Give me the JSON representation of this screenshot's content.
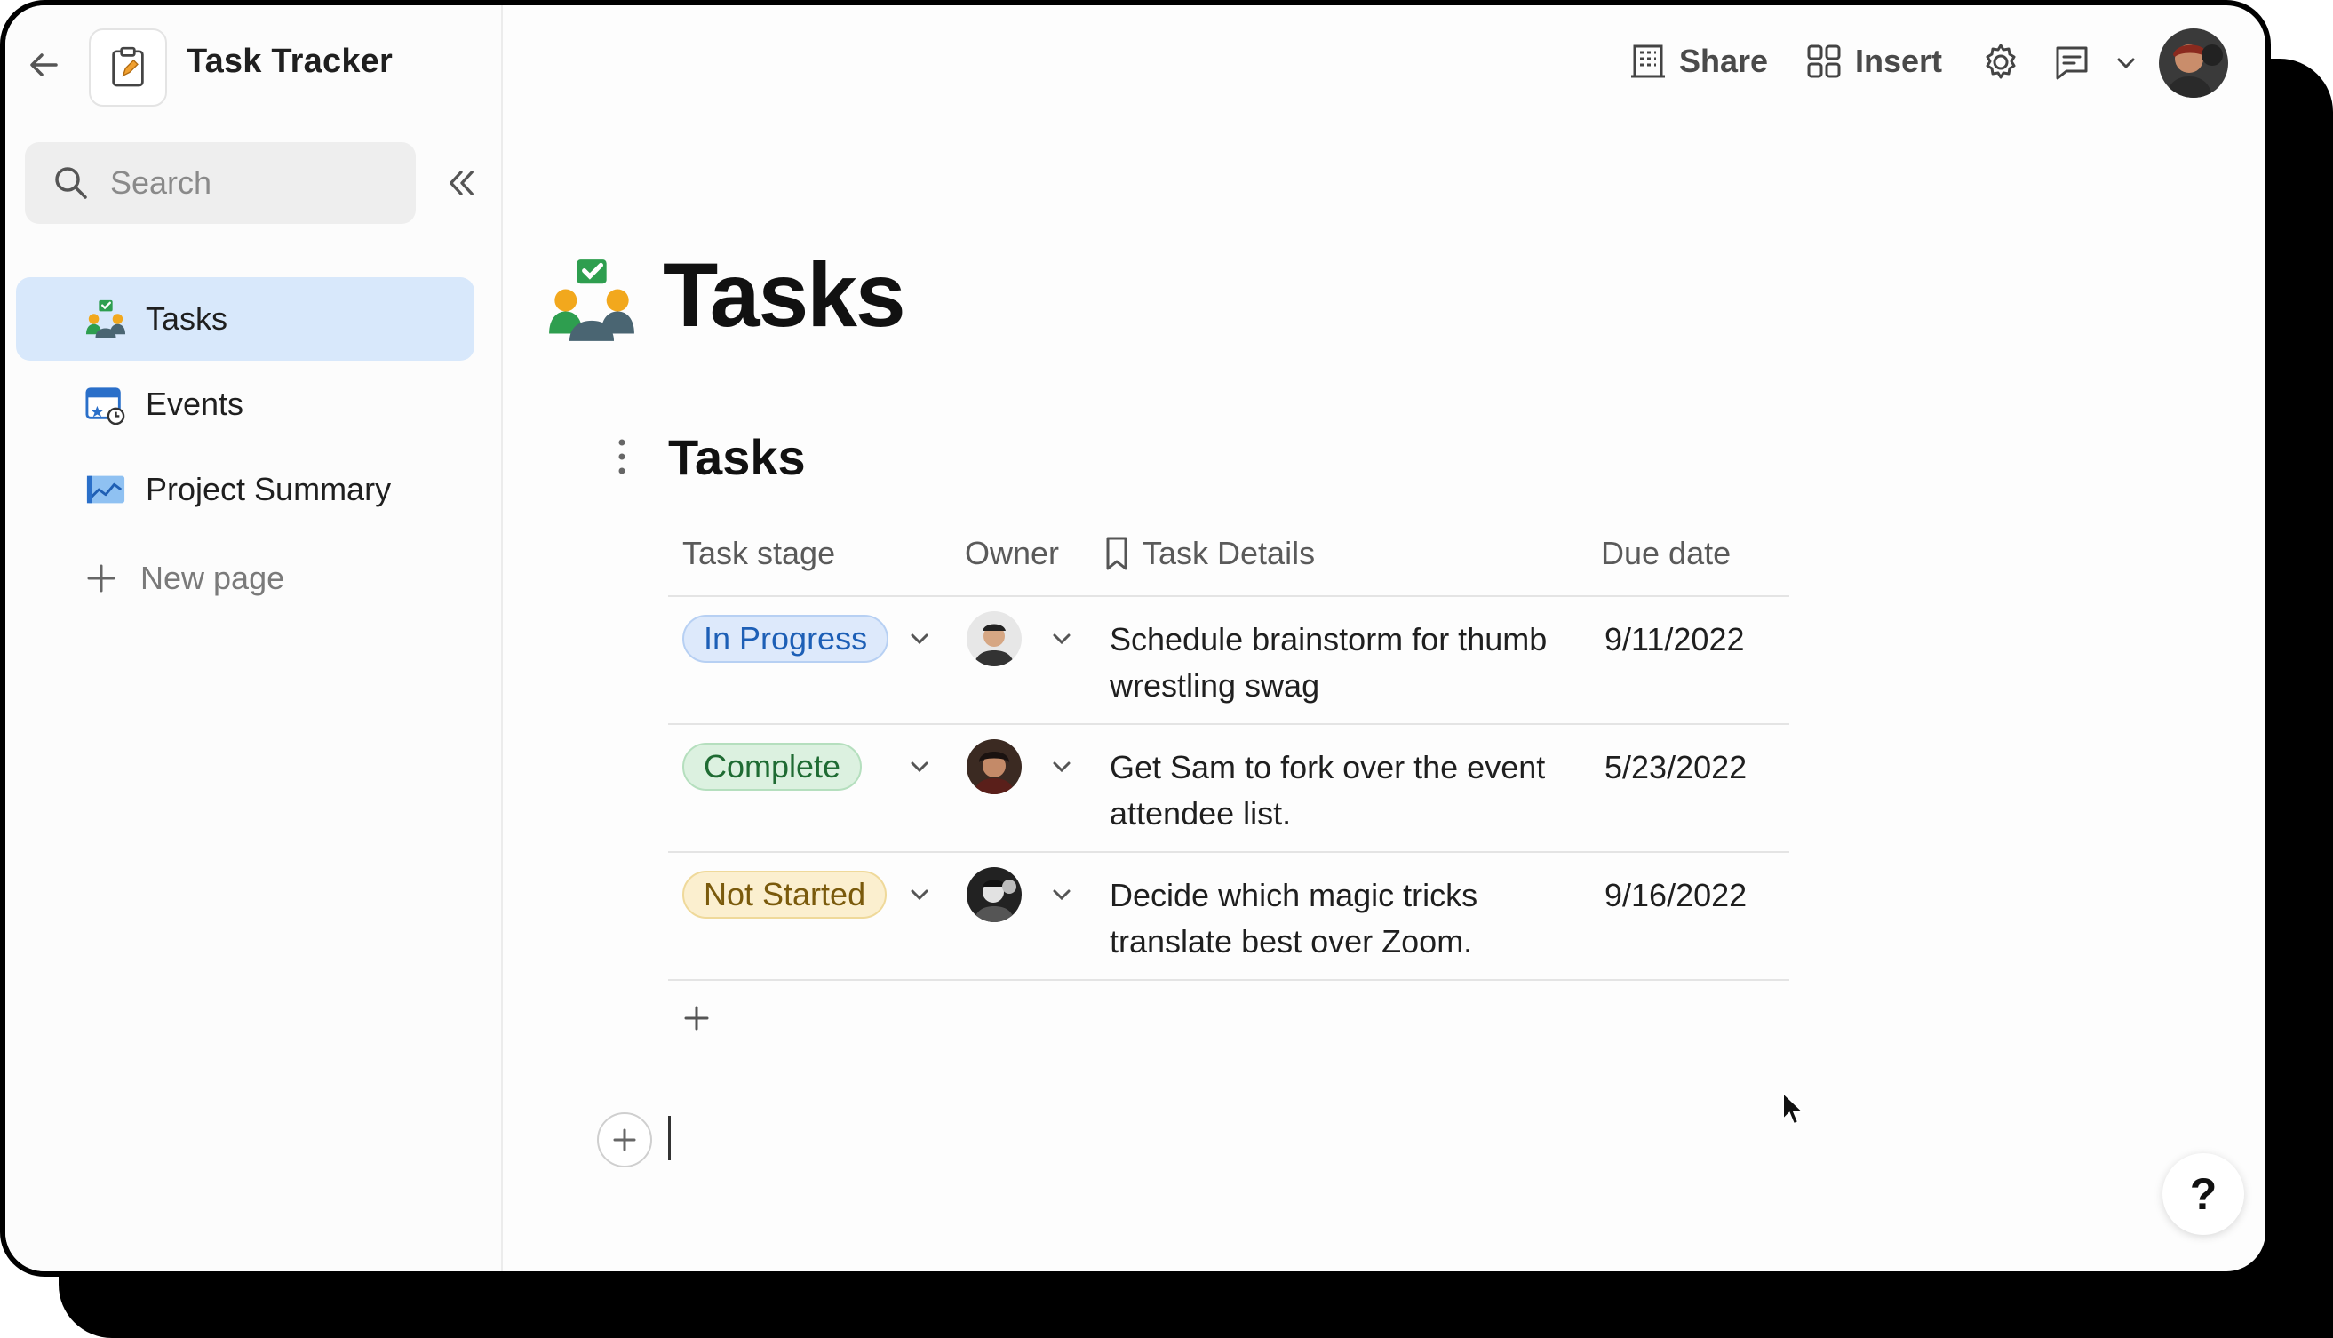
{
  "doc": {
    "title": "Task Tracker"
  },
  "search": {
    "placeholder": "Search"
  },
  "sidebar": {
    "items": [
      {
        "label": "Tasks",
        "active": true,
        "icon": "team-check-icon"
      },
      {
        "label": "Events",
        "active": false,
        "icon": "calendar-clock-icon"
      },
      {
        "label": "Project Summary",
        "active": false,
        "icon": "chart-icon"
      }
    ],
    "new_page_label": "New page"
  },
  "topbar": {
    "share_label": "Share",
    "insert_label": "Insert"
  },
  "page": {
    "title": "Tasks",
    "table_title": "Tasks"
  },
  "table": {
    "headers": {
      "stage": "Task stage",
      "owner": "Owner",
      "details": "Task Details",
      "due": "Due date"
    },
    "rows": [
      {
        "stage": "In Progress",
        "details_line1": "Schedule brainstorm for thumb",
        "details_line2": "wrestling swag",
        "due": "9/11/2022"
      },
      {
        "stage": "Complete",
        "details_line1": "Get Sam to fork over the event",
        "details_line2": "attendee list.",
        "due": "5/23/2022"
      },
      {
        "stage": "Not Started",
        "details_line1": "Decide which magic tricks",
        "details_line2": "translate best over Zoom.",
        "due": "9/16/2022"
      }
    ]
  },
  "help": {
    "label": "?"
  },
  "colors": {
    "in_progress": "#1d5fb6",
    "complete": "#1f6b33",
    "not_started": "#7a5a0c",
    "active_nav": "#d8e8fb"
  }
}
